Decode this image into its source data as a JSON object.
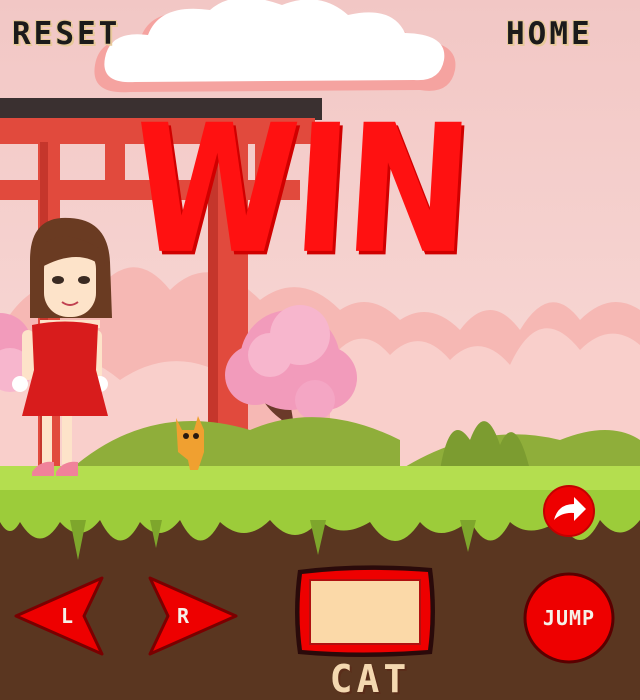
{
  "hud": {
    "reset_label": "RESET",
    "home_label": "HOME"
  },
  "result": {
    "text": "WIN"
  },
  "controls": {
    "left_label": "L",
    "right_label": "R",
    "jump_label": "JUMP",
    "share_icon": "share-arrow-icon"
  },
  "inventory": {
    "caption": "CAT"
  },
  "colors": {
    "win_red": "#ff1111",
    "button_red": "#ee0000",
    "grass": "#9ccc3a",
    "soil": "#5a3620",
    "torii": "#e14a3d",
    "sky": "#f6d6d3",
    "card": "#fbd9a8"
  }
}
